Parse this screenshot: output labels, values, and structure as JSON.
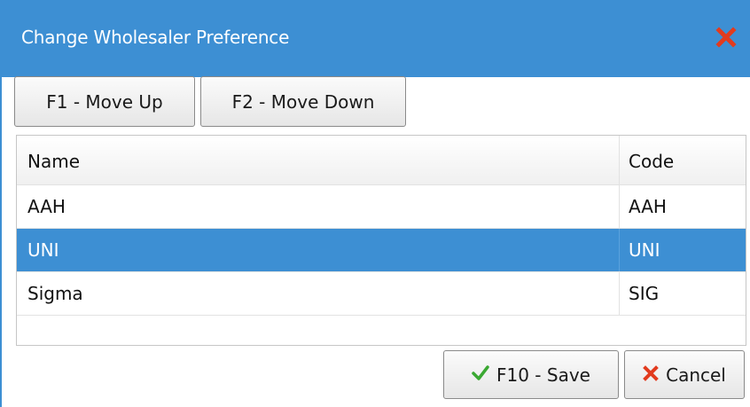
{
  "window": {
    "title": "Change Wholesaler Preference",
    "close_icon": "close-x-icon",
    "accent_color": "#3d8fd3",
    "close_color": "#e23b1e"
  },
  "toolbar": {
    "move_up_label": "F1 - Move Up",
    "move_down_label": "F2 - Move Down"
  },
  "grid": {
    "columns": [
      "Name",
      "Code"
    ],
    "rows": [
      {
        "name": "AAH",
        "code": "AAH",
        "selected": false
      },
      {
        "name": "UNI",
        "code": "UNI",
        "selected": true
      },
      {
        "name": "Sigma",
        "code": "SIG",
        "selected": false
      }
    ],
    "selection_color": "#3d8fd3"
  },
  "footer": {
    "save_label": "F10 - Save",
    "save_icon": "checkmark-icon",
    "cancel_label": "Cancel",
    "cancel_icon": "x-icon"
  }
}
